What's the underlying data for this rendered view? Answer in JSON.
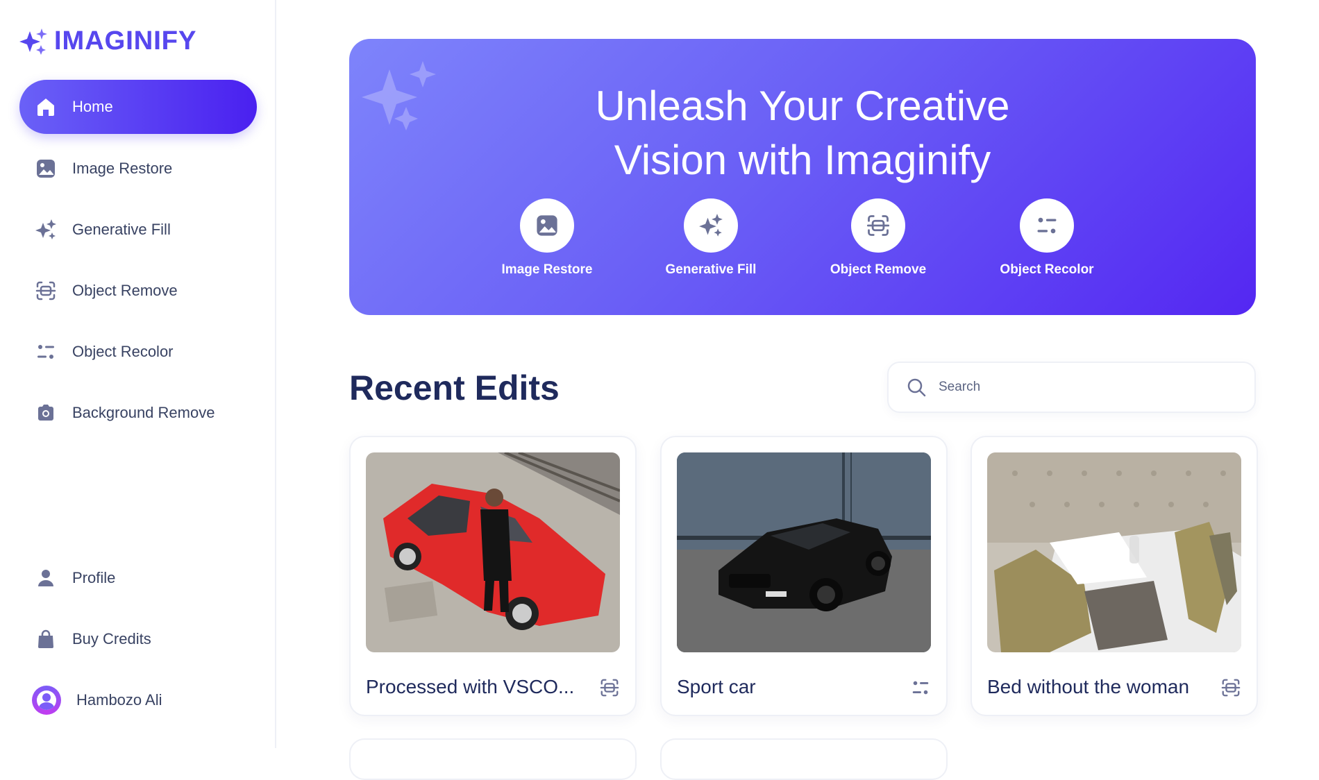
{
  "app": {
    "logo_text": "IMAGINIFY",
    "brand_color": "#5747ee"
  },
  "sidebar": {
    "items": [
      {
        "label": "Home",
        "icon": "home-icon",
        "active": true
      },
      {
        "label": "Image Restore",
        "icon": "image-icon",
        "active": false
      },
      {
        "label": "Generative Fill",
        "icon": "sparkles-icon",
        "active": false
      },
      {
        "label": "Object Remove",
        "icon": "scan-icon",
        "active": false
      },
      {
        "label": "Object Recolor",
        "icon": "filter-icon",
        "active": false
      },
      {
        "label": "Background Remove",
        "icon": "camera-icon",
        "active": false
      }
    ],
    "bottom_items": [
      {
        "label": "Profile",
        "icon": "user-icon"
      },
      {
        "label": "Buy Credits",
        "icon": "bag-icon"
      }
    ],
    "user": {
      "name": "Hambozo Ali"
    }
  },
  "hero": {
    "title_line1": "Unleash Your Creative",
    "title_line2": "Vision with Imaginify",
    "actions": [
      {
        "label": "Image Restore",
        "icon": "image-icon"
      },
      {
        "label": "Generative Fill",
        "icon": "sparkles-icon"
      },
      {
        "label": "Object Remove",
        "icon": "scan-icon"
      },
      {
        "label": "Object Recolor",
        "icon": "filter-icon"
      }
    ]
  },
  "recent": {
    "title": "Recent Edits",
    "search_placeholder": "Search",
    "cards": [
      {
        "title": "Processed with VSCO...",
        "type_icon": "scan-icon",
        "image": "red car with man"
      },
      {
        "title": "Sport car",
        "type_icon": "filter-icon",
        "image": "black sports car"
      },
      {
        "title": "Bed without the woman",
        "type_icon": "scan-icon",
        "image": "bed with pillows"
      }
    ]
  }
}
